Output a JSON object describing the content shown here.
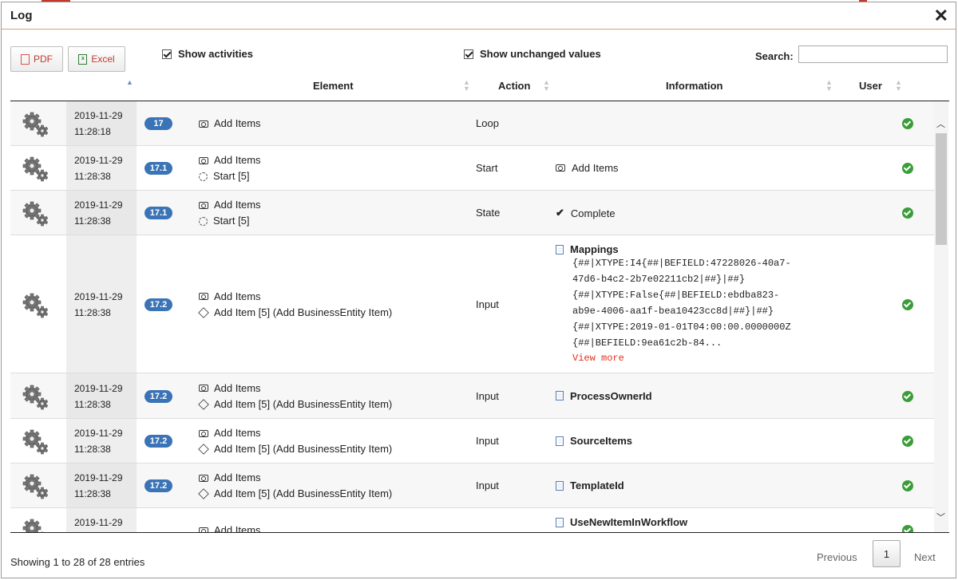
{
  "dialog": {
    "title": "Log"
  },
  "toolbar": {
    "pdf_label": "PDF",
    "excel_label": "Excel",
    "show_activities": "Show activities",
    "show_unchanged": "Show unchanged values",
    "search_label": "Search:",
    "search_value": ""
  },
  "table": {
    "columns": {
      "element": "Element",
      "action": "Action",
      "information": "Information",
      "user": "User"
    },
    "rows": [
      {
        "date": "2019-11-29",
        "time": "11:28:18",
        "badge": "17",
        "el1": "Add Items",
        "el2": "",
        "action": "Loop",
        "info": ""
      },
      {
        "date": "2019-11-29",
        "time": "11:28:38",
        "badge": "17.1",
        "el1": "Add Items",
        "el2": "Start [5]",
        "action": "Start",
        "info": "Add Items"
      },
      {
        "date": "2019-11-29",
        "time": "11:28:38",
        "badge": "17.1",
        "el1": "Add Items",
        "el2": "Start [5]",
        "action": "State",
        "info": "Complete"
      },
      {
        "date": "2019-11-29",
        "time": "11:28:38",
        "badge": "17.2",
        "el1": "Add Items",
        "el2": "Add Item [5] (Add BusinessEntity Item)",
        "action": "Input",
        "info": "Mappings",
        "detail": [
          "{##|XTYPE:I4{##|BEFIELD:47228026-40a7-",
          "47d6-b4c2-2b7e02211cb2|##}|##}",
          "{##|XTYPE:False{##|BEFIELD:ebdba823-",
          "ab9e-4006-aa1f-bea10423cc8d|##}|##}",
          "{##|XTYPE:2019-01-01T04:00:00.0000000Z",
          "{##|BEFIELD:9ea61c2b-84..."
        ],
        "view_more": "View more"
      },
      {
        "date": "2019-11-29",
        "time": "11:28:38",
        "badge": "17.2",
        "el1": "Add Items",
        "el2": "Add Item [5] (Add BusinessEntity Item)",
        "action": "Input",
        "info": "ProcessOwnerId"
      },
      {
        "date": "2019-11-29",
        "time": "11:28:38",
        "badge": "17.2",
        "el1": "Add Items",
        "el2": "Add Item [5] (Add BusinessEntity Item)",
        "action": "Input",
        "info": "SourceItems"
      },
      {
        "date": "2019-11-29",
        "time": "11:28:38",
        "badge": "17.2",
        "el1": "Add Items",
        "el2": "Add Item [5] (Add BusinessEntity Item)",
        "action": "Input",
        "info": "TemplateId"
      },
      {
        "date": "2019-11-29",
        "time": "",
        "badge": "",
        "el1": "Add Items",
        "el2": "",
        "action": "",
        "info": "UseNewItemInWorkflow"
      }
    ]
  },
  "footer": {
    "info": "Showing 1 to 28 of 28 entries",
    "previous": "Previous",
    "current_page": "1",
    "next": "Next"
  },
  "colors": {
    "badge": "#3a74b6",
    "ok": "#3a9d3a",
    "link": "#e0301e",
    "accent_rule": "#d9a07a"
  }
}
